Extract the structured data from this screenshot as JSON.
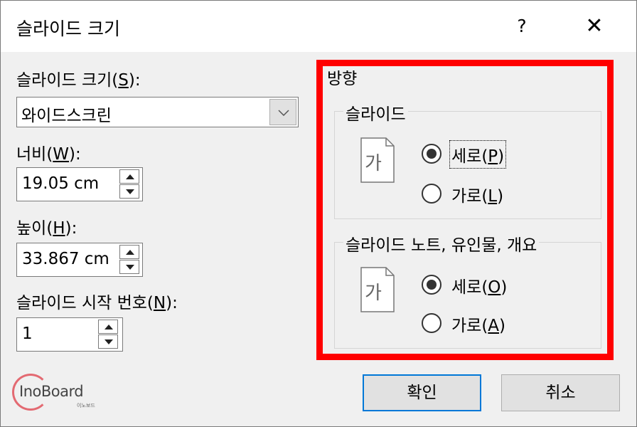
{
  "dialog": {
    "title": "슬라이드 크기",
    "help": "?",
    "close": "✕"
  },
  "left": {
    "size_label_main": "슬라이드 크기(",
    "size_label_key": "S",
    "size_label_end": "):",
    "size_value": "와이드스크린",
    "width_label_main": "너비(",
    "width_label_key": "W",
    "width_label_end": "):",
    "width_value": "19.05 cm",
    "height_label_main": "높이(",
    "height_label_key": "H",
    "height_label_end": "):",
    "height_value": "33.867 cm",
    "start_label_main": "슬라이드 시작 번호(",
    "start_label_key": "N",
    "start_label_end": "):",
    "start_value": "1"
  },
  "orientation": {
    "title": "방향",
    "slides": {
      "title": "슬라이드",
      "icon_glyph": "가",
      "portrait_main": "세로(",
      "portrait_key": "P",
      "portrait_end": ")",
      "landscape_main": "가로(",
      "landscape_key": "L",
      "landscape_end": ")",
      "selected": "portrait"
    },
    "notes": {
      "title": "슬라이드 노트, 유인물, 개요",
      "icon_glyph": "가",
      "portrait_main": "세로(",
      "portrait_key": "O",
      "portrait_end": ")",
      "landscape_main": "가로(",
      "landscape_key": "A",
      "landscape_end": ")",
      "selected": "portrait"
    }
  },
  "buttons": {
    "ok": "확인",
    "cancel": "취소"
  },
  "watermark": {
    "logo_text": "InoBoard",
    "logo_sub": "이노보드"
  },
  "colors": {
    "highlight": "#ff0000",
    "focus_border": "#0078d7",
    "logo_accent": "#e36a72"
  }
}
